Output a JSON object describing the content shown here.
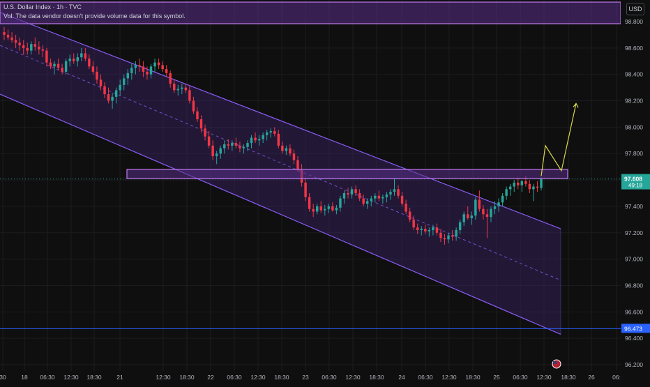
{
  "header": {
    "symbol_line": "U.S. Dollar Index · 1h · TVC",
    "volume_note": "Vol: The data vendor doesn't provide volume data for this symbol.",
    "currency": "USD"
  },
  "colors": {
    "background": "#0f0f0f",
    "grid": "#1c1c1f",
    "up": "#26a69a",
    "down": "#f23645",
    "channel": "#8a5cf6",
    "channel_fill": "#3a2466",
    "zone_fill": "#5a2f88",
    "zone_border": "#c17af0",
    "support_line": "#2962ff",
    "projection": "#d8d84a",
    "axis_text": "#b2b5be"
  },
  "chart_data": {
    "type": "candlestick",
    "symbol": "U.S. Dollar Index",
    "interval": "1h",
    "source": "TVC",
    "currency": "USD",
    "ylim": [
      96.15,
      98.85
    ],
    "y_ticks": [
      "98.800",
      "98.600",
      "98.400",
      "98.200",
      "98.000",
      "97.800",
      "97.600",
      "97.400",
      "97.200",
      "97.000",
      "96.800",
      "96.600",
      "96.400",
      "96.200"
    ],
    "x_ticks": [
      "30",
      "18",
      "06:30",
      "12:30",
      "18:30",
      "21",
      "12:30",
      "18:30",
      "22",
      "06:30",
      "12:30",
      "18:30",
      "23",
      "06:30",
      "12:30",
      "18:30",
      "24",
      "06:30",
      "12:30",
      "18:30",
      "25",
      "06:30",
      "12:30",
      "18:30",
      "26",
      "06:"
    ],
    "current_price": {
      "value": "97.608",
      "countdown": "49:18"
    },
    "support_price": {
      "value": "96.473"
    },
    "resistance_zone": {
      "low": 97.61,
      "high": 97.68
    },
    "descending_channel": {
      "upper_start": 98.87,
      "upper_end": 97.23,
      "lower_start": 98.25,
      "lower_end": 96.43,
      "mid_start": 98.62,
      "mid_end": 96.84
    },
    "projection_path": [
      97.63,
      97.86,
      97.67,
      98.18
    ],
    "candles": [
      [
        98.72,
        98.76,
        98.66,
        98.7
      ],
      [
        98.7,
        98.74,
        98.66,
        98.68
      ],
      [
        98.68,
        98.72,
        98.64,
        98.66
      ],
      [
        98.66,
        98.7,
        98.6,
        98.64
      ],
      [
        98.64,
        98.68,
        98.58,
        98.62
      ],
      [
        98.62,
        98.66,
        98.55,
        98.6
      ],
      [
        98.6,
        98.64,
        98.55,
        98.58
      ],
      [
        98.58,
        98.65,
        98.55,
        98.63
      ],
      [
        98.63,
        98.68,
        98.58,
        98.61
      ],
      [
        98.61,
        98.65,
        98.55,
        98.59
      ],
      [
        98.59,
        98.62,
        98.53,
        98.58
      ],
      [
        98.58,
        98.6,
        98.46,
        98.49
      ],
      [
        98.49,
        98.52,
        98.44,
        98.46
      ],
      [
        98.46,
        98.5,
        98.4,
        98.48
      ],
      [
        98.48,
        98.52,
        98.43,
        98.45
      ],
      [
        98.45,
        98.48,
        98.4,
        98.42
      ],
      [
        98.42,
        98.52,
        98.4,
        98.5
      ],
      [
        98.5,
        98.55,
        98.46,
        98.52
      ],
      [
        98.52,
        98.56,
        98.48,
        98.5
      ],
      [
        98.5,
        98.56,
        98.46,
        98.53
      ],
      [
        98.53,
        98.6,
        98.5,
        98.56
      ],
      [
        98.56,
        98.6,
        98.5,
        98.52
      ],
      [
        98.52,
        98.55,
        98.44,
        98.46
      ],
      [
        98.46,
        98.5,
        98.4,
        98.42
      ],
      [
        98.42,
        98.46,
        98.33,
        98.36
      ],
      [
        98.36,
        98.4,
        98.28,
        98.31
      ],
      [
        98.31,
        98.34,
        98.22,
        98.25
      ],
      [
        98.25,
        98.3,
        98.18,
        98.2
      ],
      [
        98.2,
        98.26,
        98.14,
        98.23
      ],
      [
        98.23,
        98.3,
        98.18,
        98.28
      ],
      [
        98.28,
        98.36,
        98.24,
        98.32
      ],
      [
        98.32,
        98.4,
        98.28,
        98.37
      ],
      [
        98.37,
        98.44,
        98.32,
        98.41
      ],
      [
        98.41,
        98.48,
        98.36,
        98.45
      ],
      [
        98.45,
        98.5,
        98.4,
        98.47
      ],
      [
        98.47,
        98.52,
        98.42,
        98.46
      ],
      [
        98.46,
        98.5,
        98.38,
        98.42
      ],
      [
        98.42,
        98.46,
        98.36,
        98.4
      ],
      [
        98.4,
        98.48,
        98.37,
        98.46
      ],
      [
        98.46,
        98.52,
        98.42,
        98.49
      ],
      [
        98.49,
        98.52,
        98.44,
        98.47
      ],
      [
        98.47,
        98.5,
        98.42,
        98.44
      ],
      [
        98.44,
        98.47,
        98.38,
        98.41
      ],
      [
        98.41,
        98.43,
        98.3,
        98.33
      ],
      [
        98.33,
        98.36,
        98.26,
        98.28
      ],
      [
        98.28,
        98.32,
        98.24,
        98.29
      ],
      [
        98.29,
        98.33,
        98.25,
        98.3
      ],
      [
        98.3,
        98.33,
        98.26,
        98.28
      ],
      [
        98.28,
        98.31,
        98.18,
        98.2
      ],
      [
        98.2,
        98.23,
        98.1,
        98.12
      ],
      [
        98.12,
        98.15,
        98.04,
        98.06
      ],
      [
        98.06,
        98.09,
        97.96,
        97.99
      ],
      [
        97.99,
        98.02,
        97.9,
        97.93
      ],
      [
        97.93,
        97.97,
        97.84,
        97.86
      ],
      [
        97.86,
        97.9,
        97.75,
        97.78
      ],
      [
        97.78,
        97.82,
        97.72,
        97.8
      ],
      [
        97.8,
        97.86,
        97.76,
        97.84
      ],
      [
        97.84,
        97.9,
        97.8,
        97.87
      ],
      [
        97.87,
        97.91,
        97.83,
        97.86
      ],
      [
        97.86,
        97.9,
        97.82,
        97.88
      ],
      [
        97.88,
        97.92,
        97.84,
        97.86
      ],
      [
        97.86,
        97.89,
        97.81,
        97.84
      ],
      [
        97.84,
        97.87,
        97.8,
        97.85
      ],
      [
        97.85,
        97.9,
        97.82,
        97.88
      ],
      [
        97.88,
        97.94,
        97.84,
        97.92
      ],
      [
        97.92,
        97.96,
        97.88,
        97.9
      ],
      [
        97.9,
        97.94,
        97.86,
        97.91
      ],
      [
        97.91,
        97.96,
        97.88,
        97.94
      ],
      [
        97.94,
        97.98,
        97.9,
        97.96
      ],
      [
        97.96,
        97.99,
        97.92,
        97.97
      ],
      [
        97.97,
        98.0,
        97.93,
        97.95
      ],
      [
        97.95,
        97.98,
        97.84,
        97.86
      ],
      [
        97.86,
        97.89,
        97.8,
        97.82
      ],
      [
        97.82,
        97.86,
        97.79,
        97.84
      ],
      [
        97.84,
        97.87,
        97.78,
        97.8
      ],
      [
        97.8,
        97.83,
        97.72,
        97.75
      ],
      [
        97.75,
        97.78,
        97.66,
        97.68
      ],
      [
        97.68,
        97.72,
        97.55,
        97.58
      ],
      [
        97.58,
        97.61,
        97.44,
        97.47
      ],
      [
        97.47,
        97.5,
        97.36,
        97.38
      ],
      [
        97.38,
        97.42,
        97.32,
        97.36
      ],
      [
        97.36,
        97.42,
        97.34,
        97.4
      ],
      [
        97.4,
        97.44,
        97.35,
        97.37
      ],
      [
        97.37,
        97.41,
        97.33,
        97.38
      ],
      [
        97.38,
        97.42,
        97.35,
        97.4
      ],
      [
        97.4,
        97.43,
        97.36,
        97.37
      ],
      [
        97.37,
        97.41,
        97.34,
        97.39
      ],
      [
        97.39,
        97.48,
        97.36,
        97.46
      ],
      [
        97.46,
        97.52,
        97.42,
        97.5
      ],
      [
        97.5,
        97.54,
        97.46,
        97.49
      ],
      [
        97.49,
        97.55,
        97.46,
        97.53
      ],
      [
        97.53,
        97.56,
        97.48,
        97.5
      ],
      [
        97.5,
        97.53,
        97.44,
        97.46
      ],
      [
        97.46,
        97.49,
        97.4,
        97.42
      ],
      [
        97.42,
        97.46,
        97.38,
        97.44
      ],
      [
        97.44,
        97.48,
        97.4,
        97.46
      ],
      [
        97.46,
        97.5,
        97.43,
        97.48
      ],
      [
        97.48,
        97.52,
        97.44,
        97.46
      ],
      [
        97.46,
        97.49,
        97.42,
        97.47
      ],
      [
        97.47,
        97.51,
        97.43,
        97.49
      ],
      [
        97.49,
        97.53,
        97.45,
        97.51
      ],
      [
        97.51,
        97.61,
        97.48,
        97.53
      ],
      [
        97.53,
        97.56,
        97.46,
        97.48
      ],
      [
        97.48,
        97.51,
        97.4,
        97.42
      ],
      [
        97.42,
        97.45,
        97.34,
        97.36
      ],
      [
        97.36,
        97.39,
        97.28,
        97.3
      ],
      [
        97.3,
        97.33,
        97.22,
        97.24
      ],
      [
        97.24,
        97.27,
        97.19,
        97.22
      ],
      [
        97.22,
        97.25,
        97.18,
        97.23
      ],
      [
        97.23,
        97.26,
        97.19,
        97.21
      ],
      [
        97.21,
        97.24,
        97.17,
        97.22
      ],
      [
        97.22,
        97.26,
        97.18,
        97.24
      ],
      [
        97.24,
        97.27,
        97.18,
        97.2
      ],
      [
        97.2,
        97.23,
        97.13,
        97.16
      ],
      [
        97.16,
        97.19,
        97.11,
        97.15
      ],
      [
        97.15,
        97.2,
        97.12,
        97.18
      ],
      [
        97.18,
        97.22,
        97.14,
        97.17
      ],
      [
        97.17,
        97.24,
        97.14,
        97.22
      ],
      [
        97.22,
        97.3,
        97.19,
        97.28
      ],
      [
        97.28,
        97.36,
        97.25,
        97.34
      ],
      [
        97.34,
        97.4,
        97.3,
        97.31
      ],
      [
        97.31,
        97.36,
        97.26,
        97.33
      ],
      [
        97.33,
        97.47,
        97.3,
        97.45
      ],
      [
        97.45,
        97.52,
        97.36,
        97.38
      ],
      [
        97.38,
        97.41,
        97.3,
        97.34
      ],
      [
        97.34,
        97.38,
        97.16,
        97.32
      ],
      [
        97.32,
        97.4,
        97.28,
        97.38
      ],
      [
        97.38,
        97.44,
        97.34,
        97.4
      ],
      [
        97.4,
        97.46,
        97.36,
        97.43
      ],
      [
        97.43,
        97.5,
        97.4,
        97.48
      ],
      [
        97.48,
        97.55,
        97.45,
        97.53
      ],
      [
        97.53,
        97.57,
        97.48,
        97.55
      ],
      [
        97.55,
        97.6,
        97.51,
        97.58
      ],
      [
        97.58,
        97.62,
        97.53,
        97.56
      ],
      [
        97.56,
        97.6,
        97.51,
        97.59
      ],
      [
        97.59,
        97.63,
        97.55,
        97.57
      ],
      [
        97.57,
        97.6,
        97.5,
        97.53
      ],
      [
        97.53,
        97.57,
        97.44,
        97.55
      ],
      [
        97.55,
        97.59,
        97.51,
        97.54
      ],
      [
        97.54,
        97.62,
        97.52,
        97.61
      ]
    ]
  }
}
